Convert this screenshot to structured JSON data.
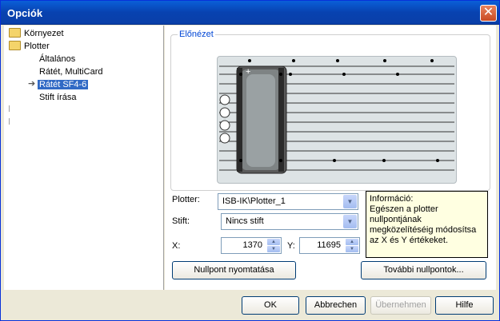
{
  "window": {
    "title": "Opciók"
  },
  "tree": {
    "items": [
      {
        "label": "Környezet"
      },
      {
        "label": "Plotter"
      },
      {
        "label": "Általános"
      },
      {
        "label": "Rátét, MultiCard"
      },
      {
        "label": "Rátét SF4-6"
      },
      {
        "label": "Stift írása"
      }
    ]
  },
  "preview": {
    "label": "Előnézet"
  },
  "form": {
    "plotter_label": "Plotter:",
    "plotter_value": "ISB-IK\\Plotter_1",
    "stift_label": "Stift:",
    "stift_value": "Nincs stift",
    "x_label": "X:",
    "x_value": "1370",
    "y_label": "Y:",
    "y_value": "11695"
  },
  "info": {
    "title": "Információ:",
    "text": "Egészen a plotter nullpontjának megközelítéséig módosítsa az X és Y értékeket."
  },
  "buttons": {
    "print_zero": "Nullpont nyomtatása",
    "more_zero": "További nullpontok...",
    "ok": "OK",
    "cancel": "Abbrechen",
    "apply": "Übernehmen",
    "help": "Hilfe"
  }
}
